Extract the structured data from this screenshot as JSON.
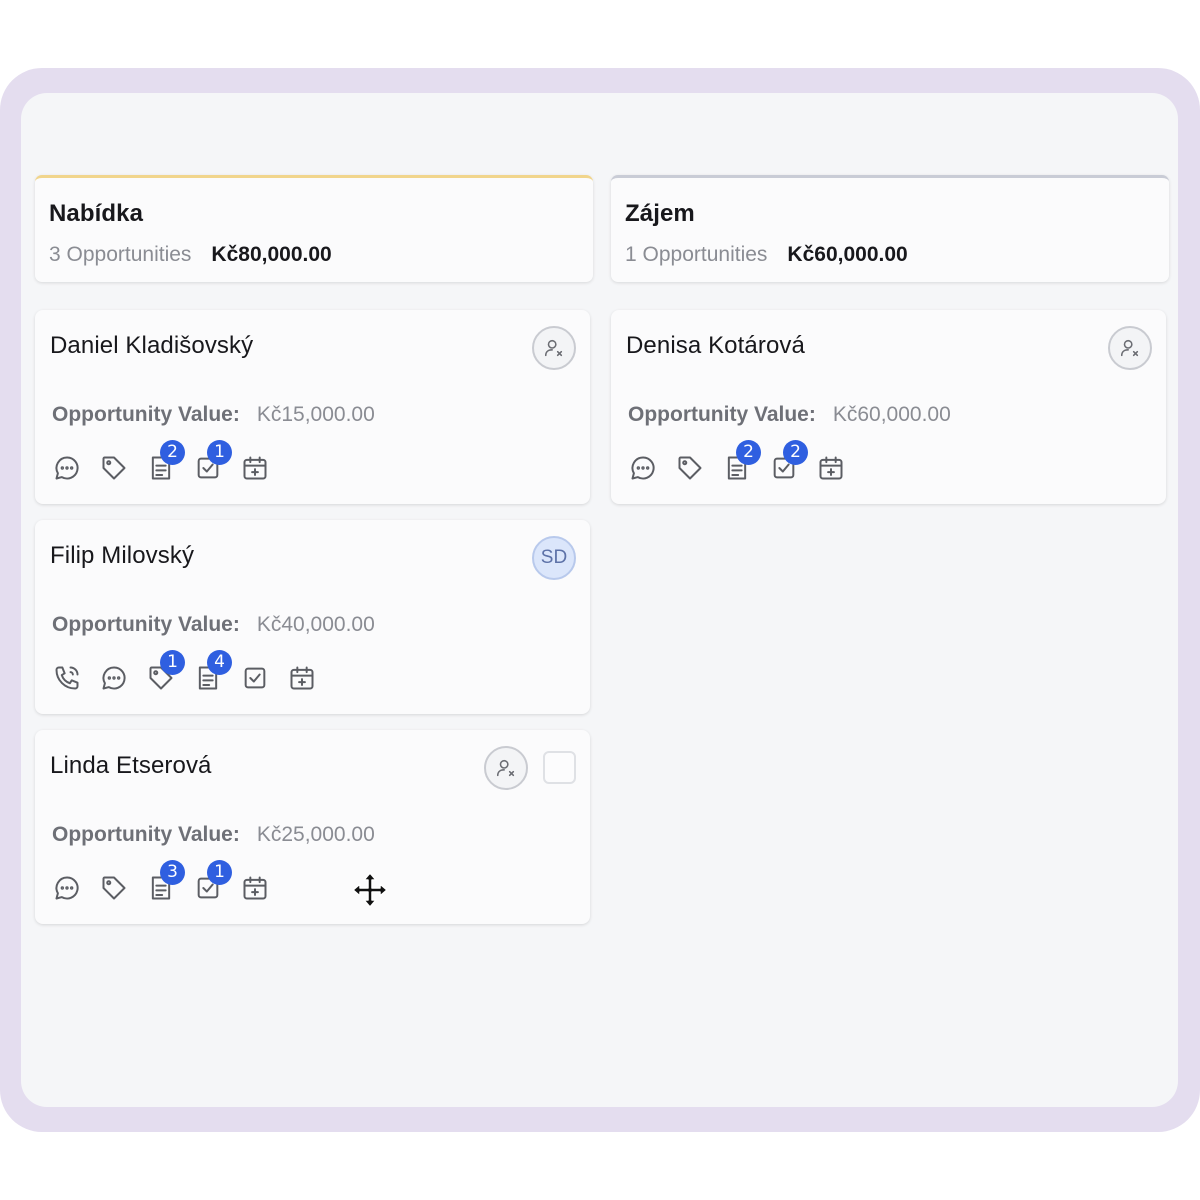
{
  "columns": [
    {
      "title": "Nabídka",
      "count": "3 Opportunities",
      "total": "Kč80,000.00",
      "cards": [
        {
          "name": "Daniel Kladišovský",
          "value_label": "Opportunity Value:",
          "value": "Kč15,000.00",
          "badges": {
            "notes": "2",
            "tasks": "1"
          }
        },
        {
          "name": "Filip Milovský",
          "value_label": "Opportunity Value:",
          "value": "Kč40,000.00",
          "avatar": "SD",
          "badges": {
            "tags": "1",
            "notes": "4"
          }
        },
        {
          "name": "Linda Etserová",
          "value_label": "Opportunity Value:",
          "value": "Kč25,000.00",
          "badges": {
            "notes": "3",
            "tasks": "1"
          }
        }
      ]
    },
    {
      "title": "Zájem",
      "count": "1 Opportunities",
      "total": "Kč60,000.00",
      "cards": [
        {
          "name": "Denisa Kotárová",
          "value_label": "Opportunity Value:",
          "value": "Kč60,000.00",
          "badges": {
            "notes": "2",
            "tasks": "2"
          }
        }
      ]
    }
  ],
  "colors": {
    "frame": "#e4ddef",
    "board": "#f5f6f8",
    "badge": "#2f5fe0",
    "stage_accent_nabidka": "#f1d58c",
    "stage_accent_zajem": "#c9ccd6"
  },
  "icons": [
    "phone-icon",
    "chat-icon",
    "tag-icon",
    "note-icon",
    "task-icon",
    "calendar-add-icon",
    "unassigned-user-icon",
    "move-cursor-icon"
  ]
}
